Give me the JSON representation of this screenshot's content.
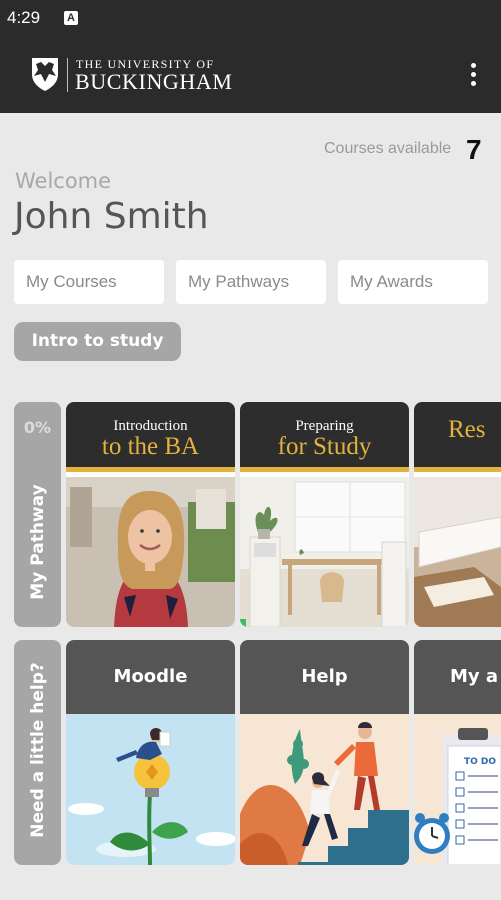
{
  "status_bar": {
    "time": "4:29",
    "notification_glyph": "A"
  },
  "header": {
    "logo_line1": "THE UNIVERSITY OF",
    "logo_line2": "BUCKINGHAM",
    "menu_icon": "kebab-menu-icon"
  },
  "summary": {
    "courses_label": "Courses available",
    "courses_count": "7"
  },
  "greeting": {
    "welcome": "Welcome",
    "name": "John Smith"
  },
  "tabs": [
    {
      "label": "My Courses"
    },
    {
      "label": "My Pathways"
    },
    {
      "label": "My Awards"
    }
  ],
  "intro_button": {
    "label": "Intro to study"
  },
  "pathway": {
    "label": "My Pathway",
    "progress": "0%",
    "cards": [
      {
        "line1": "Introduction",
        "line2": "to the BA"
      },
      {
        "line1": "Preparing",
        "line2": "for Study"
      },
      {
        "line1": "",
        "line2": "Res"
      }
    ]
  },
  "help": {
    "label": "Need a little help?",
    "cards": [
      {
        "title": "Moodle"
      },
      {
        "title": "Help"
      },
      {
        "title": "My a"
      }
    ]
  },
  "colors": {
    "header_bg": "#2b2b2b",
    "accent_gold": "#e3b23c",
    "label_grey": "#a6a6a6"
  }
}
